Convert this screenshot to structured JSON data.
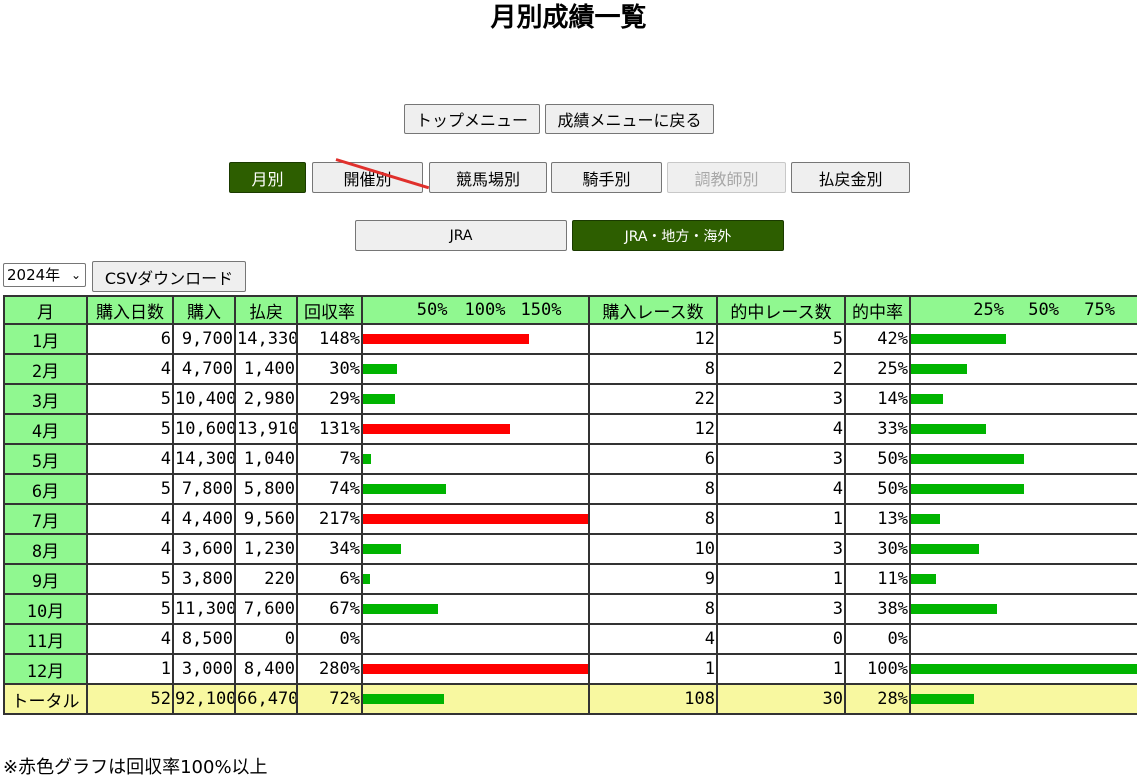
{
  "page": {
    "title": "月別成績一覧",
    "note": "※赤色グラフは回収率100%以上"
  },
  "nav": {
    "top_menu": "トップメニュー",
    "back_menu": "成績メニューに戻る"
  },
  "tabs": [
    {
      "label": "月別",
      "state": "active"
    },
    {
      "label": "開催別",
      "state": "normal"
    },
    {
      "label": "競馬場別",
      "state": "normal"
    },
    {
      "label": "騎手別",
      "state": "normal"
    },
    {
      "label": "調教師別",
      "state": "disabled"
    },
    {
      "label": "払戻金別",
      "state": "normal"
    }
  ],
  "filters": [
    {
      "label": "JRA",
      "state": "normal"
    },
    {
      "label": "JRA・地方・海外",
      "state": "active"
    }
  ],
  "controls": {
    "year": "2024年",
    "csv_label": "CSVダウンロード"
  },
  "table": {
    "headers": {
      "month": "月",
      "days": "購入日数",
      "purchase": "購入",
      "payout": "払戻",
      "return_rate": "回収率",
      "races": "購入レース数",
      "hit_races": "的中レース数",
      "hit_rate": "的中率"
    },
    "return_scale": [
      "50%",
      "100%",
      "150%"
    ],
    "hit_scale": [
      "25%",
      "50%",
      "75%"
    ],
    "rows": [
      {
        "month": "1月",
        "days": "6",
        "purchase": "9,700",
        "payout": "14,330",
        "return_rate": "148%",
        "rr": 148,
        "races": "12",
        "hits": "5",
        "hit_rate": "42%",
        "hr": 42
      },
      {
        "month": "2月",
        "days": "4",
        "purchase": "4,700",
        "payout": "1,400",
        "return_rate": "30%",
        "rr": 30,
        "races": "8",
        "hits": "2",
        "hit_rate": "25%",
        "hr": 25
      },
      {
        "month": "3月",
        "days": "5",
        "purchase": "10,400",
        "payout": "2,980",
        "return_rate": "29%",
        "rr": 29,
        "races": "22",
        "hits": "3",
        "hit_rate": "14%",
        "hr": 14
      },
      {
        "month": "4月",
        "days": "5",
        "purchase": "10,600",
        "payout": "13,910",
        "return_rate": "131%",
        "rr": 131,
        "races": "12",
        "hits": "4",
        "hit_rate": "33%",
        "hr": 33
      },
      {
        "month": "5月",
        "days": "4",
        "purchase": "14,300",
        "payout": "1,040",
        "return_rate": "7%",
        "rr": 7,
        "races": "6",
        "hits": "3",
        "hit_rate": "50%",
        "hr": 50
      },
      {
        "month": "6月",
        "days": "5",
        "purchase": "7,800",
        "payout": "5,800",
        "return_rate": "74%",
        "rr": 74,
        "races": "8",
        "hits": "4",
        "hit_rate": "50%",
        "hr": 50
      },
      {
        "month": "7月",
        "days": "4",
        "purchase": "4,400",
        "payout": "9,560",
        "return_rate": "217%",
        "rr": 217,
        "races": "8",
        "hits": "1",
        "hit_rate": "13%",
        "hr": 13
      },
      {
        "month": "8月",
        "days": "4",
        "purchase": "3,600",
        "payout": "1,230",
        "return_rate": "34%",
        "rr": 34,
        "races": "10",
        "hits": "3",
        "hit_rate": "30%",
        "hr": 30
      },
      {
        "month": "9月",
        "days": "5",
        "purchase": "3,800",
        "payout": "220",
        "return_rate": "6%",
        "rr": 6,
        "races": "9",
        "hits": "1",
        "hit_rate": "11%",
        "hr": 11
      },
      {
        "month": "10月",
        "days": "5",
        "purchase": "11,300",
        "payout": "7,600",
        "return_rate": "67%",
        "rr": 67,
        "races": "8",
        "hits": "3",
        "hit_rate": "38%",
        "hr": 38
      },
      {
        "month": "11月",
        "days": "4",
        "purchase": "8,500",
        "payout": "0",
        "return_rate": "0%",
        "rr": 0,
        "races": "4",
        "hits": "0",
        "hit_rate": "0%",
        "hr": 0
      },
      {
        "month": "12月",
        "days": "1",
        "purchase": "3,000",
        "payout": "8,400",
        "return_rate": "280%",
        "rr": 280,
        "races": "1",
        "hits": "1",
        "hit_rate": "100%",
        "hr": 100
      }
    ],
    "total": {
      "month": "トータル",
      "days": "52",
      "purchase": "92,100",
      "payout": "66,470",
      "return_rate": "72%",
      "rr": 72,
      "races": "108",
      "hits": "30",
      "hit_rate": "28%",
      "hr": 28
    }
  },
  "colors": {
    "bar_high": "#ff0000",
    "bar_normal": "#00b400",
    "header_bg": "#90f890",
    "total_bg": "#f8f8a0",
    "active_btn": "#2d5e00"
  }
}
